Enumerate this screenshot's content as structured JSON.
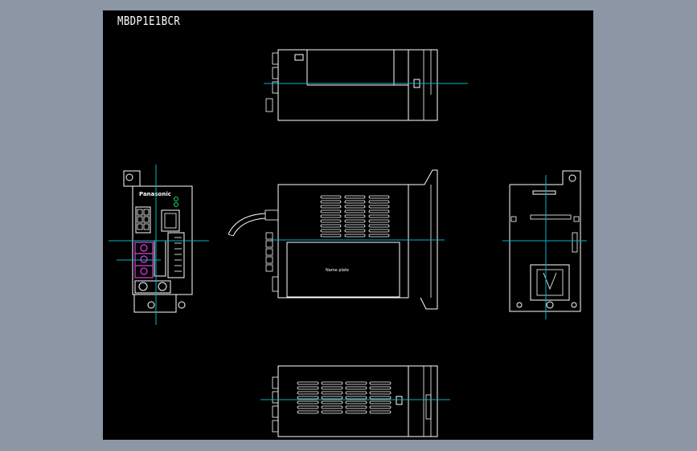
{
  "drawing": {
    "title": "MBDP1E1BCR",
    "brand_logo": "Panasonic",
    "name_plate_label": "Name plate"
  },
  "colors": {
    "background": "#8c96a4",
    "sheet": "#000000",
    "line": "#ffffff",
    "centerline": "#00b4c8",
    "terminal_highlight": "#e040e0",
    "led": "#30d860"
  },
  "views": [
    "top-view",
    "front-view",
    "side-view",
    "rear-view",
    "bottom-view"
  ]
}
